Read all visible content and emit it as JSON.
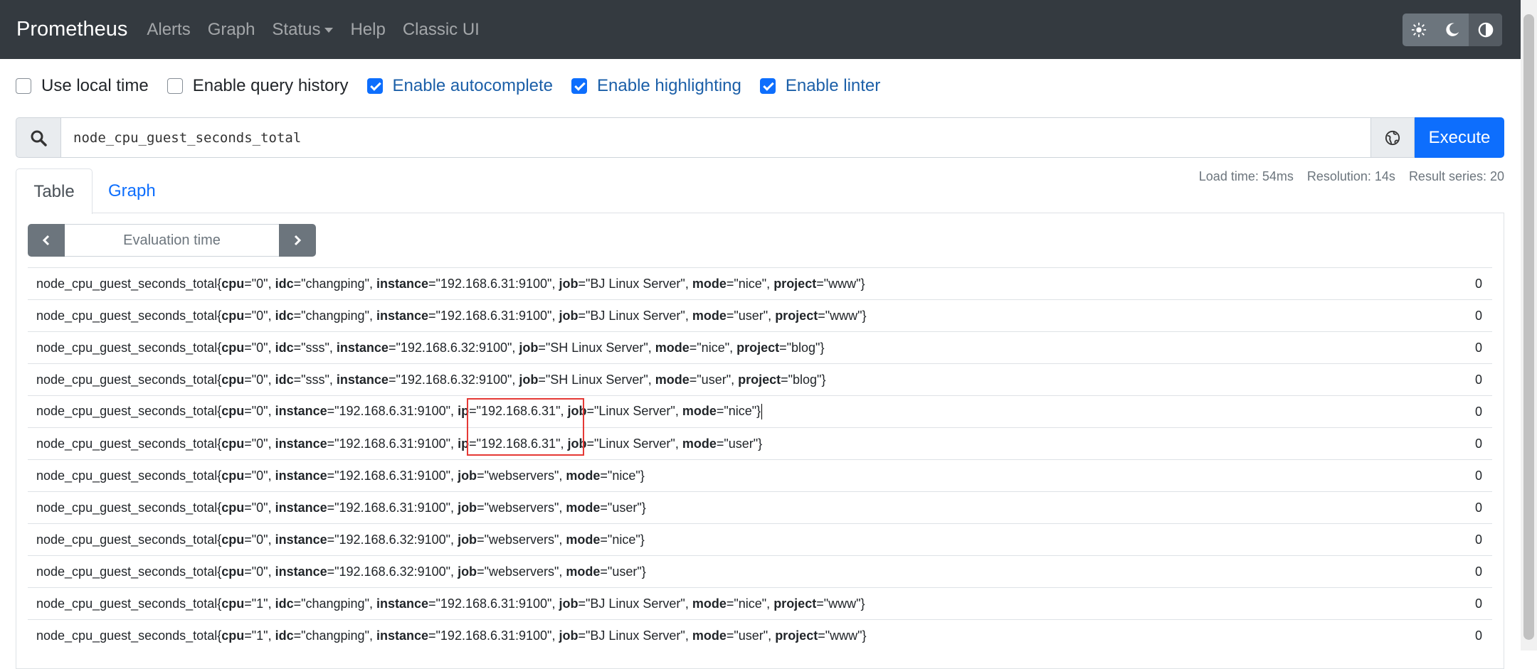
{
  "nav": {
    "brand": "Prometheus",
    "links": [
      "Alerts",
      "Graph",
      "Status",
      "Help",
      "Classic UI"
    ]
  },
  "options": [
    {
      "label": "Use local time",
      "checked": false
    },
    {
      "label": "Enable query history",
      "checked": false
    },
    {
      "label": "Enable autocomplete",
      "checked": true
    },
    {
      "label": "Enable highlighting",
      "checked": true
    },
    {
      "label": "Enable linter",
      "checked": true
    }
  ],
  "query": {
    "value": "node_cpu_guest_seconds_total",
    "execute_label": "Execute"
  },
  "tabs": {
    "table": "Table",
    "graph": "Graph"
  },
  "stats": {
    "load_time": "Load time: 54ms",
    "resolution": "Resolution: 14s",
    "result_series": "Result series: 20"
  },
  "eval_time_placeholder": "Evaluation time",
  "metric": "node_cpu_guest_seconds_total",
  "rows": [
    {
      "labels": [
        [
          "cpu",
          "0"
        ],
        [
          "idc",
          "changping"
        ],
        [
          "instance",
          "192.168.6.31:9100"
        ],
        [
          "job",
          "BJ Linux Server"
        ],
        [
          "mode",
          "nice"
        ],
        [
          "project",
          "www"
        ]
      ],
      "value": "0"
    },
    {
      "labels": [
        [
          "cpu",
          "0"
        ],
        [
          "idc",
          "changping"
        ],
        [
          "instance",
          "192.168.6.31:9100"
        ],
        [
          "job",
          "BJ Linux Server"
        ],
        [
          "mode",
          "user"
        ],
        [
          "project",
          "www"
        ]
      ],
      "value": "0"
    },
    {
      "labels": [
        [
          "cpu",
          "0"
        ],
        [
          "idc",
          "sss"
        ],
        [
          "instance",
          "192.168.6.32:9100"
        ],
        [
          "job",
          "SH Linux Server"
        ],
        [
          "mode",
          "nice"
        ],
        [
          "project",
          "blog"
        ]
      ],
      "value": "0"
    },
    {
      "labels": [
        [
          "cpu",
          "0"
        ],
        [
          "idc",
          "sss"
        ],
        [
          "instance",
          "192.168.6.32:9100"
        ],
        [
          "job",
          "SH Linux Server"
        ],
        [
          "mode",
          "user"
        ],
        [
          "project",
          "blog"
        ]
      ],
      "value": "0"
    },
    {
      "labels": [
        [
          "cpu",
          "0"
        ],
        [
          "instance",
          "192.168.6.31:9100"
        ],
        [
          "ip",
          "192.168.6.31"
        ],
        [
          "job",
          "Linux Server"
        ],
        [
          "mode",
          "nice"
        ]
      ],
      "value": "0"
    },
    {
      "labels": [
        [
          "cpu",
          "0"
        ],
        [
          "instance",
          "192.168.6.31:9100"
        ],
        [
          "ip",
          "192.168.6.31"
        ],
        [
          "job",
          "Linux Server"
        ],
        [
          "mode",
          "user"
        ]
      ],
      "value": "0"
    },
    {
      "labels": [
        [
          "cpu",
          "0"
        ],
        [
          "instance",
          "192.168.6.31:9100"
        ],
        [
          "job",
          "webservers"
        ],
        [
          "mode",
          "nice"
        ]
      ],
      "value": "0"
    },
    {
      "labels": [
        [
          "cpu",
          "0"
        ],
        [
          "instance",
          "192.168.6.31:9100"
        ],
        [
          "job",
          "webservers"
        ],
        [
          "mode",
          "user"
        ]
      ],
      "value": "0"
    },
    {
      "labels": [
        [
          "cpu",
          "0"
        ],
        [
          "instance",
          "192.168.6.32:9100"
        ],
        [
          "job",
          "webservers"
        ],
        [
          "mode",
          "nice"
        ]
      ],
      "value": "0"
    },
    {
      "labels": [
        [
          "cpu",
          "0"
        ],
        [
          "instance",
          "192.168.6.32:9100"
        ],
        [
          "job",
          "webservers"
        ],
        [
          "mode",
          "user"
        ]
      ],
      "value": "0"
    },
    {
      "labels": [
        [
          "cpu",
          "1"
        ],
        [
          "idc",
          "changping"
        ],
        [
          "instance",
          "192.168.6.31:9100"
        ],
        [
          "job",
          "BJ Linux Server"
        ],
        [
          "mode",
          "nice"
        ],
        [
          "project",
          "www"
        ]
      ],
      "value": "0"
    },
    {
      "labels": [
        [
          "cpu",
          "1"
        ],
        [
          "idc",
          "changping"
        ],
        [
          "instance",
          "192.168.6.31:9100"
        ],
        [
          "job",
          "BJ Linux Server"
        ],
        [
          "mode",
          "user"
        ],
        [
          "project",
          "www"
        ]
      ],
      "value": "0"
    }
  ],
  "icons": {
    "search": "search-icon",
    "globe": "globe-icon",
    "theme": [
      "sun-icon",
      "moon-icon",
      "contrast-icon"
    ]
  },
  "colors": {
    "navbar": "#343a40",
    "primary": "#0d6efd",
    "highlight_box": "#e53935"
  }
}
